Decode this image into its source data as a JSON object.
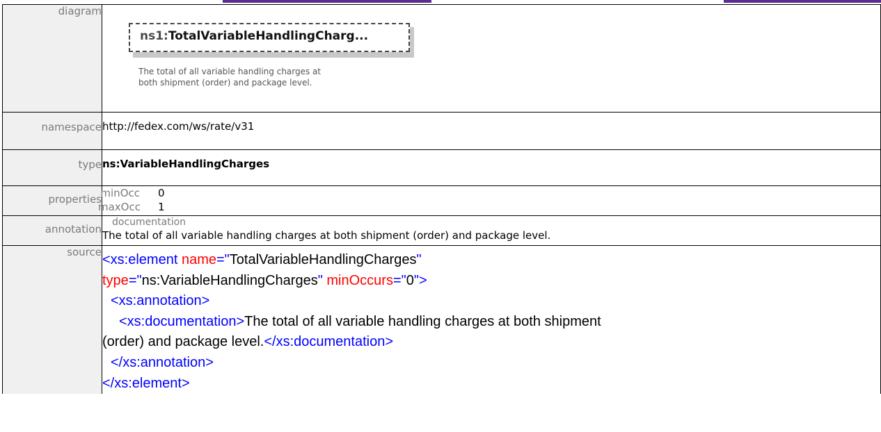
{
  "rows": {
    "diagram": {
      "label": "diagram",
      "box_prefix": "ns1:",
      "box_name": "TotalVariableHandlingCharg...",
      "doc_line1": "The total of all variable handling charges at",
      "doc_line2": "both shipment (order) and package level."
    },
    "namespace": {
      "label": "namespace",
      "value": "http://fedex.com/ws/rate/v31"
    },
    "type": {
      "label": "type",
      "value": "ns:VariableHandlingCharges"
    },
    "properties": {
      "label": "properties",
      "min_key": "minOcc",
      "min_val": "0",
      "max_key": "maxOcc",
      "max_val": "1"
    },
    "annotation": {
      "label": "annotation",
      "heading": "documentation",
      "text": "The total of all variable handling charges at both shipment (order) and package level."
    },
    "source": {
      "label": "source",
      "l1_open": "<xs:element",
      "l1_attr": " name",
      "l1_eq": "=\"",
      "l1_val": "TotalVariableHandlingCharges",
      "l1_q": "\"",
      "l2_attr": "type",
      "l2_eq": "=\"",
      "l2_val": "ns:VariableHandlingCharges",
      "l2_q": "\"",
      "l2_attr2": " minOccurs",
      "l2_eq2": "=\"",
      "l2_val2": "0",
      "l2_close": "\">",
      "l3": "<xs:annotation>",
      "l4_open": "<xs:documentation>",
      "l4_text": "The total of all variable handling charges at both shipment",
      "l5_text": "(order) and package level.",
      "l5_close": "</xs:documentation>",
      "l6": "</xs:annotation>",
      "l7": "</xs:element>"
    }
  }
}
